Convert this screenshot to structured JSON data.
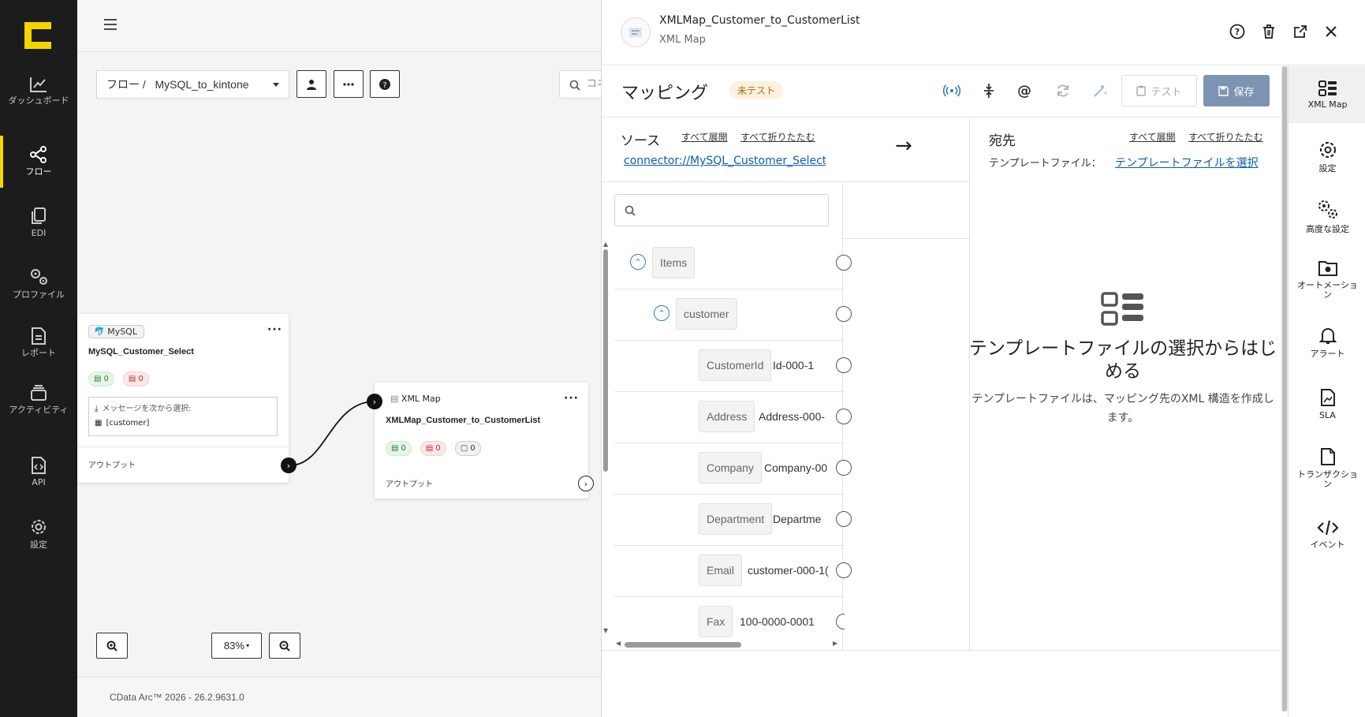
{
  "left_nav": {
    "items": [
      {
        "label": "ダッシュボード",
        "icon": "chart-line-icon"
      },
      {
        "label": "フロー",
        "icon": "share-nodes-icon",
        "active": true
      },
      {
        "label": "EDI",
        "icon": "copy-icon"
      },
      {
        "label": "プロファイル",
        "icon": "gears-icon"
      },
      {
        "label": "レポート",
        "icon": "file-lines-icon"
      },
      {
        "label": "アクティビティ",
        "icon": "layers-icon"
      },
      {
        "label": "API",
        "icon": "file-code-icon"
      },
      {
        "label": "設定",
        "icon": "gear-icon"
      }
    ]
  },
  "toolbar": {
    "flow_selector": "フロー /   MySQL_to_kintone",
    "search_placeholder": "コネ"
  },
  "nodes": {
    "mysql": {
      "type_label": "MySQL",
      "name": "MySQL_Customer_Select",
      "success_count": "0",
      "error_count": "0",
      "message_label": "メッセージを次から選択:",
      "message_value": "[customer]",
      "output_label": "アウトプット"
    },
    "xmlmap": {
      "type_label": "XML Map",
      "name": "XMLMap_Customer_to_CustomerList",
      "success_count": "0",
      "error_count": "0",
      "pending_count": "0",
      "output_label": "アウトプット"
    }
  },
  "zoom": {
    "level": "83%"
  },
  "footer": {
    "version": "CData Arc™ 2026 - 26.2.9631.0"
  },
  "panel": {
    "title": "XMLMap_Customer_to_CustomerList",
    "subtitle": "XML Map",
    "mapping_title": "マッピング",
    "status_badge": "未テスト",
    "test_label": "テスト",
    "save_label": "保存",
    "source": {
      "label": "ソース",
      "expand_all": "すべて展開",
      "collapse_all": "すべて折りたたむ",
      "connector": "connector://MySQL_Customer_Select..."
    },
    "arrow": "→",
    "destination": {
      "label": "宛先",
      "expand_all": "すべて展開",
      "collapse_all": "すべて折りたたむ",
      "template_label": "テンプレートファイル：",
      "template_link": "テンプレートファイルを選択"
    },
    "tree": [
      {
        "name": "Items",
        "value": ""
      },
      {
        "name": "customer",
        "value": ""
      },
      {
        "name": "CustomerId",
        "value": "Id-000-1"
      },
      {
        "name": "Address",
        "value": "Address-000-"
      },
      {
        "name": "Company",
        "value": "Company-00"
      },
      {
        "name": "Department",
        "value": "Departme"
      },
      {
        "name": "Email",
        "value": "customer-000-1("
      },
      {
        "name": "Fax",
        "value": "100-0000-0001"
      }
    ],
    "empty_state": {
      "heading": "テンプレートファイルの選択からはじめる",
      "body": "テンプレートファイルは、マッピング先のXML 構造を作成します。"
    }
  },
  "right_nav": {
    "items": [
      {
        "label": "XML Map",
        "icon": "grid-list-icon",
        "active": true
      },
      {
        "label": "設定",
        "icon": "gear-icon"
      },
      {
        "label": "高度な設定",
        "icon": "gears-icon"
      },
      {
        "label": "オートメーション",
        "icon": "folder-gear-icon"
      },
      {
        "label": "アラート",
        "icon": "bell-icon"
      },
      {
        "label": "SLA",
        "icon": "file-chart-icon"
      },
      {
        "label": "トランザクション",
        "icon": "file-icon"
      },
      {
        "label": "イベント",
        "icon": "code-icon"
      }
    ]
  },
  "colors": {
    "accent": "#f5d400",
    "link": "#0b5ea8",
    "save": "#7c93b4",
    "sidebar": "#1c1c1c"
  }
}
